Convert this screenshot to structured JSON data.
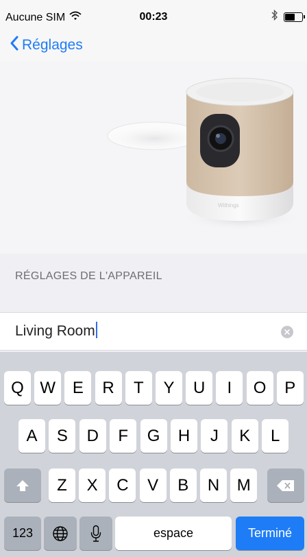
{
  "status_bar": {
    "carrier": "Aucune SIM",
    "time": "00:23",
    "battery_level": 0.6
  },
  "nav": {
    "back_label": "Réglages"
  },
  "hero": {
    "brand_text": "Withings"
  },
  "section": {
    "header": "RÉGLAGES DE L'APPAREIL"
  },
  "name_field": {
    "value": "Living Room"
  },
  "keyboard": {
    "row1": [
      "Q",
      "W",
      "E",
      "R",
      "T",
      "Y",
      "U",
      "I",
      "O",
      "P"
    ],
    "row2": [
      "A",
      "S",
      "D",
      "F",
      "G",
      "H",
      "J",
      "K",
      "L"
    ],
    "row3": [
      "Z",
      "X",
      "C",
      "V",
      "B",
      "N",
      "M"
    ],
    "numbers_label": "123",
    "space_label": "espace",
    "done_label": "Terminé"
  },
  "colors": {
    "accent": "#1e7cf6",
    "keyboard_bg": "#d0d3d9",
    "function_key": "#abb1ba"
  }
}
